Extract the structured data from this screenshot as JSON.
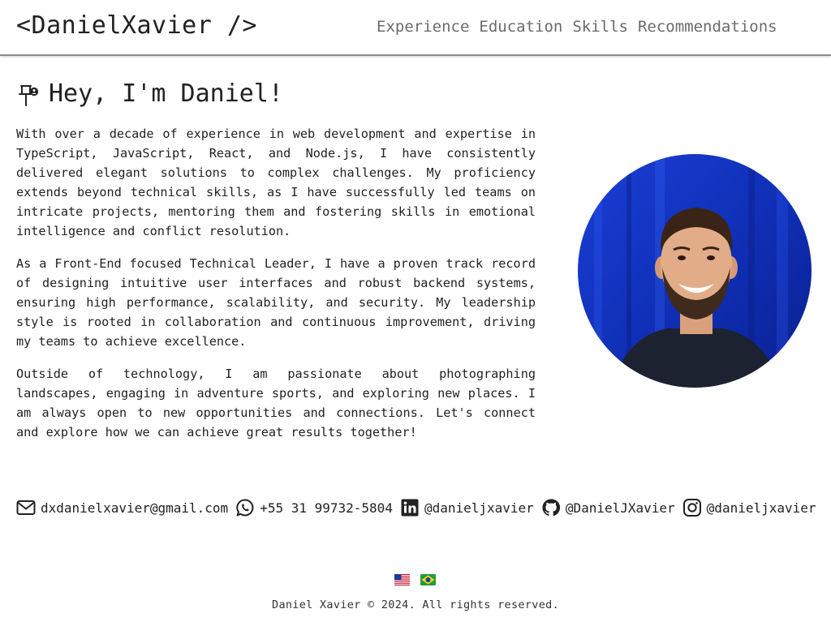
{
  "header": {
    "logo": "<DanielXavier />",
    "nav": [
      {
        "label": "Experience"
      },
      {
        "label": "Education"
      },
      {
        "label": "Skills"
      },
      {
        "label": "Recommendations"
      }
    ]
  },
  "intro": {
    "icon": "pushpin-with-person-icon",
    "title": "Hey, I'm Daniel!",
    "paragraphs": [
      "With over a decade of experience in web development and expertise in TypeScript, JavaScript, React, and Node.js, I have consistently delivered elegant solutions to complex challenges. My proficiency extends beyond technical skills, as I have successfully led teams on intricate projects, mentoring them and fostering skills in emotional intelligence and conflict resolution.",
      "As a Front-End focused Technical Leader, I have a proven track record of designing intuitive user interfaces and robust backend systems, ensuring high performance, scalability, and security. My leadership style is rooted in collaboration and continuous improvement, driving my teams to achieve excellence.",
      "Outside of technology, I am passionate about photographing landscapes, engaging in adventure sports, and exploring new places. I am always open to new opportunities and connections. Let's connect and explore how we can achieve great results together!"
    ]
  },
  "contacts": [
    {
      "icon": "envelope-icon",
      "label": "dxdanielxavier@gmail.com"
    },
    {
      "icon": "whatsapp-icon",
      "label": "+55 31 99732-5804"
    },
    {
      "icon": "linkedin-icon",
      "label": "@danieljxavier"
    },
    {
      "icon": "github-icon",
      "label": "@DanielJXavier"
    },
    {
      "icon": "instagram-icon",
      "label": "@danieljxavier"
    }
  ],
  "footer": {
    "languages": [
      {
        "icon": "us-flag-icon"
      },
      {
        "icon": "brazil-flag-icon"
      }
    ],
    "copyright": "Daniel Xavier © 2024. All rights reserved."
  },
  "colors": {
    "text": "#222222",
    "nav": "#6b6b6b",
    "header_border": "#8a8a8a",
    "avatar_background": "#1436c8"
  }
}
